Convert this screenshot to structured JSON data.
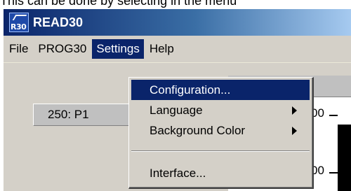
{
  "caption": "This can be done by selecting in the menu",
  "window": {
    "title": "READ30",
    "icon_text": "R30"
  },
  "menubar": {
    "items": [
      "File",
      "PROG30",
      "Settings",
      "Help"
    ]
  },
  "content": {
    "row_label": "250: P1",
    "axis_ticks": [
      "00",
      "00"
    ]
  },
  "dropdown": {
    "items": [
      {
        "label": "Configuration...",
        "submenu": false
      },
      {
        "label": "Language",
        "submenu": true
      },
      {
        "label": "Background Color",
        "submenu": true
      },
      {
        "label": "Interface...",
        "submenu": false
      }
    ]
  },
  "colors": {
    "highlight": "#0a246a",
    "face": "#d4d0c8"
  }
}
